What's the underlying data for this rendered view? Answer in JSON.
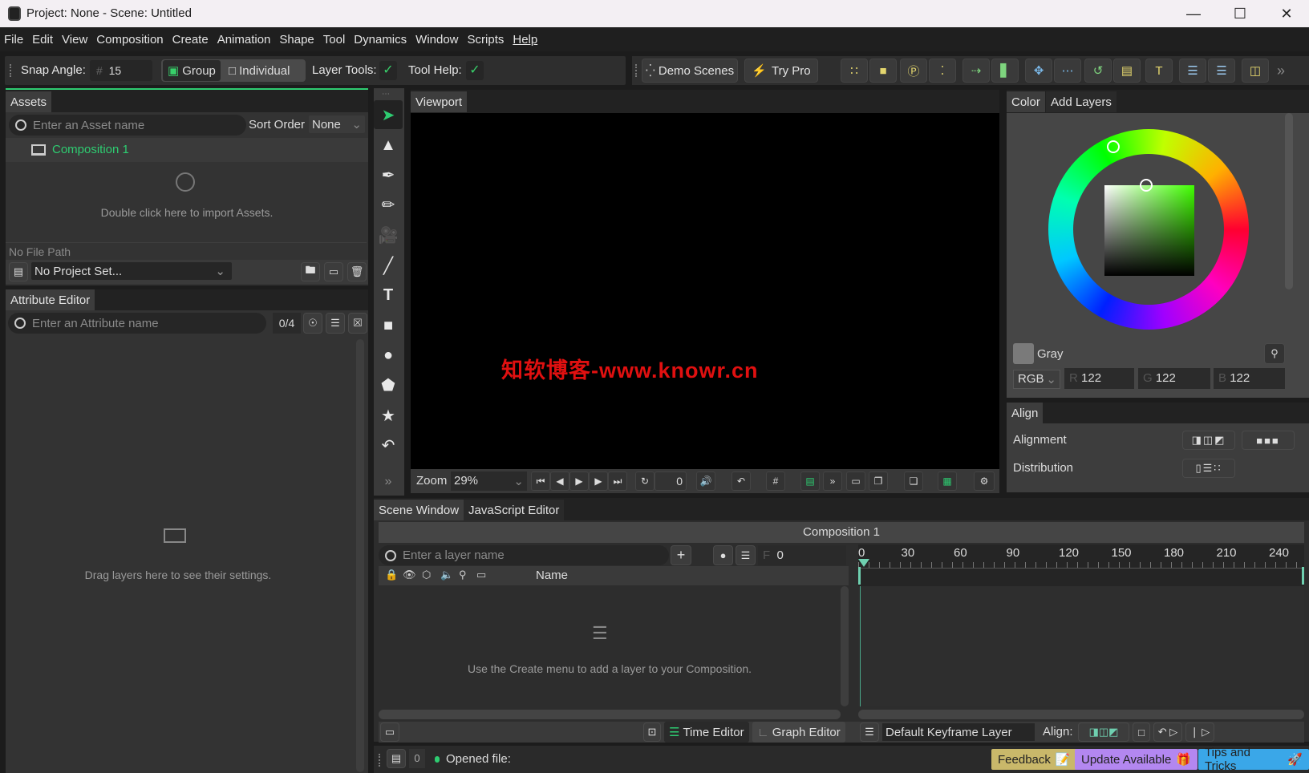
{
  "window": {
    "title": "Project: None - Scene: Untitled"
  },
  "menu": [
    "File",
    "Edit",
    "View",
    "Composition",
    "Create",
    "Animation",
    "Shape",
    "Tool",
    "Dynamics",
    "Window",
    "Scripts",
    "Help"
  ],
  "toolbar": {
    "snap_angle_label": "Snap Angle:",
    "snap_angle_value": "15",
    "group_label": "Group",
    "individual_label": "Individual",
    "layer_tools_label": "Layer Tools:",
    "tool_help_label": "Tool Help:",
    "demo_scenes_label": "Demo Scenes",
    "try_pro_label": "Try Pro"
  },
  "assets": {
    "tab": "Assets",
    "search_placeholder": "Enter an Asset name",
    "sort_order_label": "Sort Order",
    "sort_order_value": "None",
    "items": [
      {
        "name": "Composition 1"
      }
    ],
    "import_hint": "Double click here to import Assets.",
    "file_path": "No File Path",
    "project_select": "No Project Set..."
  },
  "attribute_editor": {
    "tab": "Attribute Editor",
    "search_placeholder": "Enter an Attribute name",
    "count": "0/4",
    "hint": "Drag layers here to see their settings."
  },
  "viewport": {
    "tab": "Viewport",
    "watermark": "知软博客-www.knowr.cn",
    "zoom_label": "Zoom",
    "zoom_value": "29%",
    "frame_value": "0"
  },
  "color": {
    "tabs": [
      "Color",
      "Add Layers"
    ],
    "swatch_name": "Gray",
    "swatch_color": "#7a7a7a",
    "mode": "RGB",
    "r": "122",
    "g": "122",
    "b": "122",
    "r_label": "R",
    "g_label": "G",
    "b_label": "B"
  },
  "align": {
    "tab": "Align",
    "alignment_label": "Alignment",
    "distribution_label": "Distribution"
  },
  "scene": {
    "tabs": [
      "Scene Window",
      "JavaScript Editor"
    ],
    "composition_title": "Composition 1",
    "layer_search_placeholder": "Enter a layer name",
    "frame_label": "F",
    "frame_value": "0",
    "name_column": "Name",
    "empty_hint": "Use the Create menu to add a layer to your Composition.",
    "ruler_ticks": [
      "0",
      "30",
      "60",
      "90",
      "120",
      "150",
      "180",
      "210",
      "240"
    ],
    "time_editor_label": "Time Editor",
    "graph_editor_label": "Graph Editor",
    "keyframe_layer": "Default Keyframe Layer",
    "align_label": "Align:"
  },
  "status": {
    "count": "0",
    "message": "Opened file:",
    "feedback": "Feedback",
    "update": "Update Available",
    "tips": "Tips and Tricks"
  },
  "colors": {
    "accent": "#2ecc71",
    "feedback_bg": "#c9b86a",
    "update_bg": "#b387f0",
    "tips_bg": "#3aa7e8",
    "watermark": "#e01010"
  }
}
